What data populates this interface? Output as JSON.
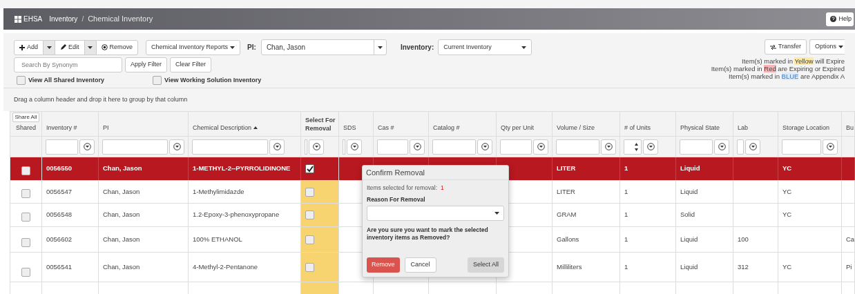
{
  "header": {
    "app": "EHSA",
    "breadcrumb": [
      "Inventory",
      "Chemical Inventory"
    ],
    "separator": "/",
    "help": "Help"
  },
  "toolbar": {
    "add": "Add",
    "edit": "Edit",
    "remove": "Remove",
    "reports": "Chemical Inventory Reports",
    "pi_label": "PI:",
    "pi_value": "Chan, Jason",
    "inventory_label": "Inventory:",
    "inventory_value": "Current Inventory",
    "transfer": "Transfer",
    "options": "Options",
    "search_placeholder": "Search By Synonym",
    "apply": "Apply Filter",
    "clear": "Clear Filter",
    "toggles": [
      {
        "label": "View All Shared Inventory",
        "checked": false
      },
      {
        "label": "View Working Solution Inventory",
        "checked": false
      }
    ]
  },
  "legend": [
    {
      "before": "Item(s) marked in ",
      "mark": "Yellow",
      "after": " will Expire",
      "color": "#fde9a8"
    },
    {
      "before": "Item(s) marked in ",
      "mark": "Red",
      "after": " are Expiring or Expired",
      "color": "#f4b6b6"
    },
    {
      "before": "Item(s) marked in ",
      "mark": "BLUE",
      "after": " are Appendix A",
      "color": "#dde9f7"
    }
  ],
  "group_hint": "Drag a column header and drop it here to group by that column",
  "columns": [
    {
      "label": "Shared",
      "kind": "checkbox",
      "filter": {
        "kind": "none"
      },
      "action": "Share All",
      "sorted": false
    },
    {
      "label": "Inventory #",
      "kind": "text",
      "filter": {
        "kind": "text"
      },
      "sorted": false
    },
    {
      "label": "PI",
      "kind": "text",
      "filter": {
        "kind": "text"
      },
      "sorted": false
    },
    {
      "label": "Chemical Description",
      "kind": "text",
      "filter": {
        "kind": "text"
      },
      "sorted": true
    },
    {
      "label": "Select For Removal",
      "kind": "removal",
      "filter": {
        "kind": "bar"
      },
      "sorted": false
    },
    {
      "label": "SDS",
      "kind": "text",
      "filter": {
        "kind": "bar"
      },
      "sorted": false
    },
    {
      "label": "Cas #",
      "kind": "text",
      "filter": {
        "kind": "text"
      },
      "sorted": false
    },
    {
      "label": "Catalog #",
      "kind": "text",
      "filter": {
        "kind": "text"
      },
      "sorted": false
    },
    {
      "label": "Qty per Unit",
      "kind": "text",
      "filter": {
        "kind": "text"
      },
      "sorted": false
    },
    {
      "label": "Volume / Size",
      "kind": "text",
      "filter": {
        "kind": "text"
      },
      "sorted": false
    },
    {
      "label": "# of Units",
      "kind": "text",
      "filter": {
        "kind": "spinner"
      },
      "sorted": false
    },
    {
      "label": "Physical State",
      "kind": "text",
      "filter": {
        "kind": "text"
      },
      "sorted": false
    },
    {
      "label": "Lab",
      "kind": "text",
      "filter": {
        "kind": "narrow"
      },
      "sorted": false
    },
    {
      "label": "Storage Location",
      "kind": "text",
      "filter": {
        "kind": "text"
      },
      "sorted": false
    },
    {
      "label": "Bu",
      "kind": "text",
      "filter": {
        "kind": "none"
      },
      "sorted": false
    }
  ],
  "rows": [
    {
      "selected": true,
      "shared": false,
      "removal": true,
      "cells": [
        null,
        "0056550",
        "Chan, Jason",
        "1-METHYL-2--PYRROLIDINONE",
        null,
        null,
        null,
        null,
        null,
        "LITER",
        "1",
        "Liquid",
        null,
        "YC",
        null
      ]
    },
    {
      "selected": false,
      "shared": false,
      "removal": false,
      "cells": [
        null,
        "0056547",
        "Chan, Jason",
        "1-Methylimidazde",
        null,
        null,
        null,
        null,
        null,
        "LITER",
        "1",
        "Liquid",
        null,
        "YC",
        null
      ]
    },
    {
      "selected": false,
      "shared": false,
      "removal": false,
      "cells": [
        null,
        "0056548",
        "Chan, Jason",
        "1.2-Epoxy-3-phenoxypropane",
        null,
        null,
        null,
        null,
        null,
        "GRAM",
        "1",
        "Solid",
        null,
        "YC",
        null
      ]
    },
    {
      "selected": false,
      "shared": false,
      "removal": false,
      "cells": [
        null,
        "0056602",
        "Chan, Jason",
        "100% ETHANOL",
        null,
        null,
        null,
        null,
        null,
        "Gallons",
        "1",
        "Liquid",
        "100",
        null,
        "Ca"
      ]
    },
    {
      "selected": false,
      "shared": false,
      "removal": false,
      "cells": [
        null,
        "0056541",
        "Chan, Jason",
        "4-Methyl-2-Pentanone",
        null,
        null,
        null,
        null,
        null,
        "Milliliters",
        "1",
        "Liquid",
        "312",
        "YC",
        "Pi"
      ]
    }
  ],
  "dialog": {
    "title": "Confirm Removal",
    "count_label": "Items selected for removal:",
    "count": "1",
    "reason_label": "Reason For Removal",
    "question": "Are you sure you want to mark the selected inventory items as Removed?",
    "remove": "Remove",
    "cancel": "Cancel",
    "select_all": "Select All"
  }
}
